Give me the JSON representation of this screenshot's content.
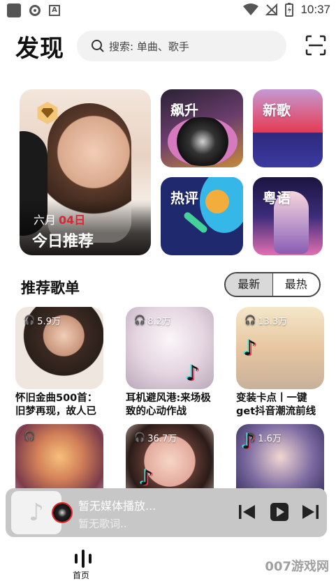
{
  "status": {
    "time": "10:37"
  },
  "header": {
    "title": "发现",
    "search_placeholder": "搜索: 单曲、歌手"
  },
  "hero": {
    "month": "六月",
    "day": "04日",
    "label": "今日推荐"
  },
  "tiles": [
    "飙升",
    "新歌",
    "热评",
    "粤语"
  ],
  "section": {
    "title": "推荐歌单",
    "tab_new": "最新",
    "tab_hot": "最热",
    "active_tab": "最新"
  },
  "playlists": [
    {
      "plays": "5.9万",
      "title": "怀旧金曲500首：旧梦再现，故人已"
    },
    {
      "plays": "8.2万",
      "title": "耳机避风港:来场极致的心动作战"
    },
    {
      "plays": "13.3万",
      "title": "变装卡点丨一键get抖音潮流前线"
    },
    {
      "plays": "",
      "title": ""
    },
    {
      "plays": "36.7万",
      "title": ""
    },
    {
      "plays": "1.6万",
      "title": ""
    }
  ],
  "player": {
    "title": "暂无媒体播放...",
    "subtitle": "暂无歌词.."
  },
  "nav": {
    "home_label": "首页"
  },
  "watermark": "007游戏网",
  "colors": {
    "accent_red": "#e0232e",
    "player_bg": "#c7c7c7"
  }
}
